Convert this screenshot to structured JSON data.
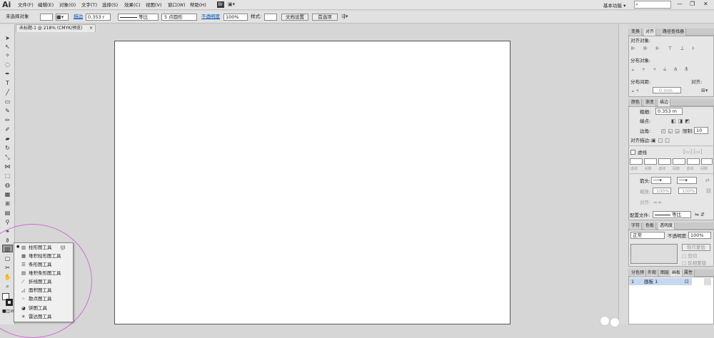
{
  "app": {
    "logo": "Ai"
  },
  "menu": [
    "文件(F)",
    "编辑(E)",
    "对象(O)",
    "文字(T)",
    "选择(S)",
    "效果(C)",
    "视图(V)",
    "窗口(W)",
    "帮助(H)"
  ],
  "titlebar": {
    "bridge": "Br",
    "workspace": "基本功能",
    "workspace_arrow": "▾",
    "minimize": "—",
    "restore": "❐",
    "close": "✕"
  },
  "control": {
    "selection": "未选择对象",
    "stroke_label": "描边",
    "stroke_value": "0.353 r",
    "profile": "等比",
    "brush": "5 点圆形",
    "opacity_label": "不透明度",
    "opacity_value": "100%",
    "style_label": "样式:",
    "doc_setup": "文档设置",
    "preferences": "首选项"
  },
  "document": {
    "tab": "未标题-1 @ 218% (CMYK/预览)",
    "close": "×"
  },
  "graph_menu": [
    {
      "icon": "bar-chart-icon",
      "glyph": "▥",
      "label": "柱形图工具",
      "shortcut": "(J)",
      "active": true
    },
    {
      "icon": "stacked-bar-icon",
      "glyph": "▦",
      "label": "堆积柱形图工具"
    },
    {
      "icon": "horizontal-bar-icon",
      "glyph": "☰",
      "label": "条形图工具"
    },
    {
      "icon": "stacked-horizontal-bar-icon",
      "glyph": "▤",
      "label": "堆积条形图工具"
    },
    {
      "icon": "line-graph-icon",
      "glyph": "⟋",
      "label": "折线图工具"
    },
    {
      "icon": "area-graph-icon",
      "glyph": "◿",
      "label": "面积图工具"
    },
    {
      "icon": "scatter-graph-icon",
      "glyph": "⁘",
      "label": "散点图工具"
    },
    {
      "icon": "pie-graph-icon",
      "glyph": "◕",
      "label": "饼图工具"
    },
    {
      "icon": "radar-graph-icon",
      "glyph": "✳",
      "label": "雷达图工具"
    }
  ],
  "align_panel": {
    "tabs": [
      "变换",
      "对齐",
      "路径查找器"
    ],
    "align_objects": "对齐对象:",
    "distribute_objects": "分布对象:",
    "distribute_spacing": "分布间距:",
    "spacing_value": "0 mm",
    "align_to": "对齐:"
  },
  "stroke_panel": {
    "tabs": [
      "颜色",
      "渐变",
      "描边"
    ],
    "weight_label": "粗细:",
    "weight_value": "0.353 m",
    "cap_label": "端点:",
    "corner_label": "边角:",
    "limit_label": "限制:",
    "limit_value": "10",
    "align_label": "对齐描边:",
    "dashed_label": "虚线",
    "dash_cells": [
      "虚线",
      "间隙",
      "虚线",
      "间隙",
      "虚线",
      "间隙"
    ],
    "arrow_label": "箭头:",
    "scale_label": "缩放:",
    "scale_a": "100%",
    "scale_b": "100%",
    "align2_label": "对齐:",
    "profile_label": "配置文件:",
    "profile_value": "等比"
  },
  "transparency_panel": {
    "tabs": [
      "字符",
      "色板",
      "透明度"
    ],
    "mode": "正常",
    "opacity_label": "不透明度:",
    "opacity_value": "100%",
    "mask_button": "制作蒙版",
    "clip": "剪切",
    "invert": "反相蒙版"
  },
  "artboards_panel": {
    "tabs": [
      "分色预",
      "外观",
      "图层",
      "画板",
      "属性"
    ],
    "rows": [
      {
        "index": "1",
        "name": "画板 1"
      }
    ]
  },
  "colors": {
    "accent": "#0050b4",
    "highlight_ellipse": "#d46bd4",
    "selected_row": "#c6d8f0"
  }
}
